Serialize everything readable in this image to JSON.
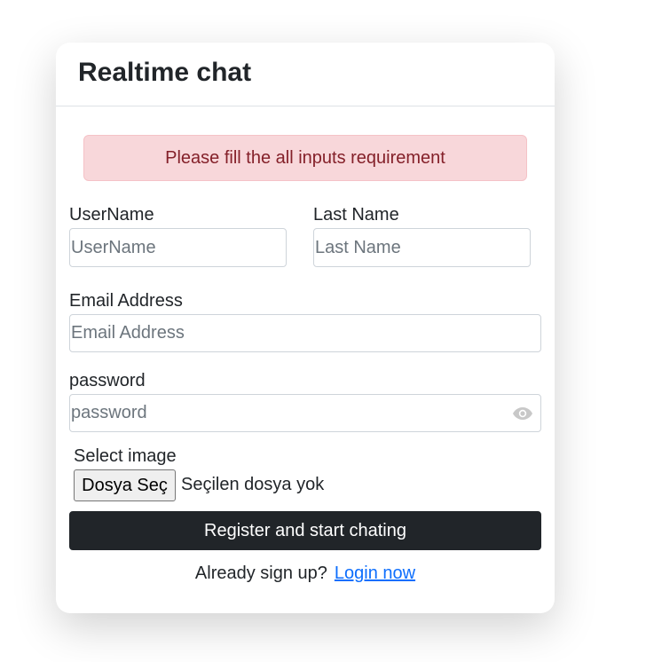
{
  "header": {
    "title": "Realtime chat"
  },
  "alert": {
    "message": "Please fill the all inputs requirement"
  },
  "form": {
    "username": {
      "label": "UserName",
      "placeholder": "UserName",
      "value": ""
    },
    "last_name": {
      "label": "Last Name",
      "placeholder": "Last Name",
      "value": ""
    },
    "email": {
      "label": "Email Address",
      "placeholder": "Email Address",
      "value": ""
    },
    "password": {
      "label": "password",
      "placeholder": "password",
      "value": "",
      "toggle_icon": "eye-icon"
    },
    "image": {
      "label": "Select image",
      "button_label": "Dosya Seç",
      "status": "Seçilen dosya yok"
    },
    "submit_label": "Register and start chating"
  },
  "footer": {
    "prompt": "Already sign up?",
    "link_label": "Login now"
  },
  "colors": {
    "alert_bg": "#f8d7da",
    "alert_text": "#842029",
    "button_bg": "#212529",
    "link": "#0d6efd"
  }
}
